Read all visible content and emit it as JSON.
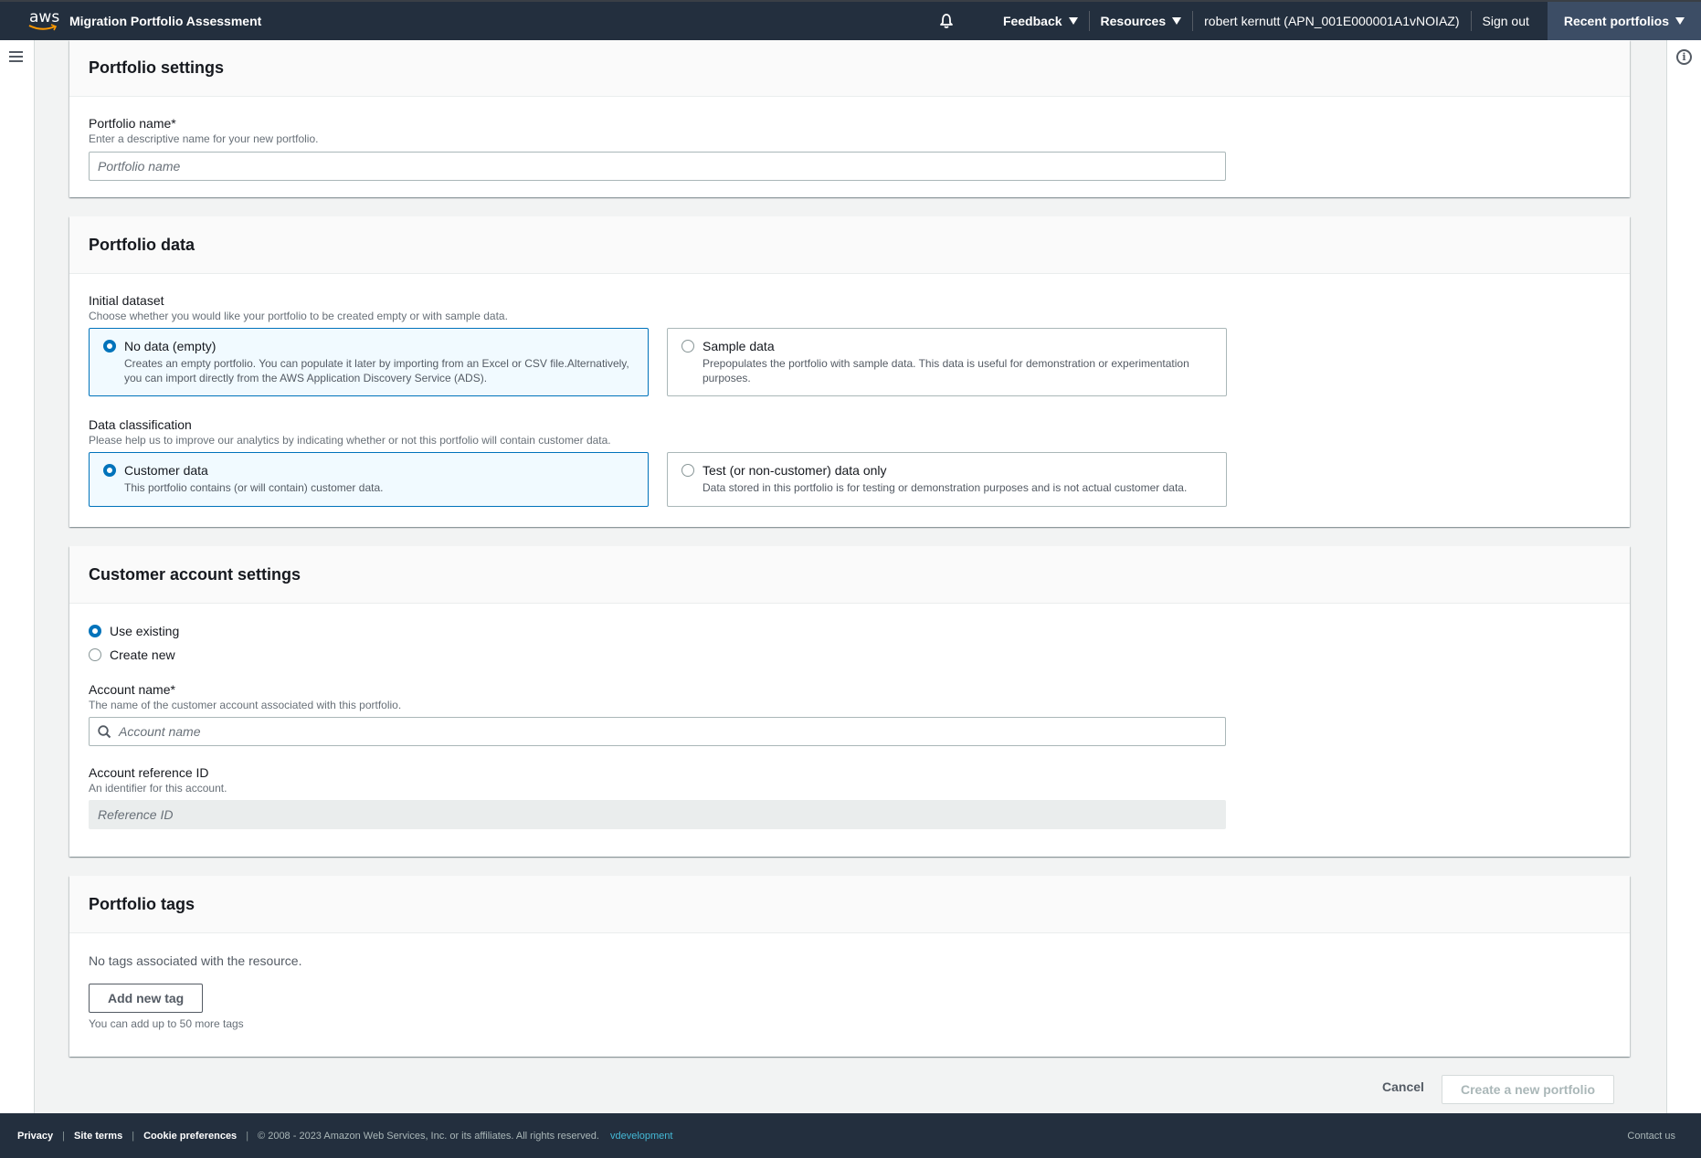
{
  "topnav": {
    "logo_text": "aws",
    "app_title": "Migration Portfolio Assessment",
    "feedback": "Feedback",
    "resources": "Resources",
    "user": "robert kernutt (APN_001E000001A1vNOIAZ)",
    "sign_out": "Sign out",
    "recent_portfolios": "Recent portfolios"
  },
  "portfolio_settings": {
    "title": "Portfolio settings",
    "name_label": "Portfolio name*",
    "name_desc": "Enter a descriptive name for your new portfolio.",
    "name_placeholder": "Portfolio name",
    "name_value": ""
  },
  "portfolio_data": {
    "title": "Portfolio data",
    "initial_dataset": {
      "label": "Initial dataset",
      "desc": "Choose whether you would like your portfolio to be created empty or with sample data.",
      "options": [
        {
          "title": "No data (empty)",
          "desc": "Creates an empty portfolio. You can populate it later by importing from an Excel or CSV file.Alternatively, you can import directly from the AWS Application Discovery Service (ADS).",
          "selected": true
        },
        {
          "title": "Sample data",
          "desc": "Prepopulates the portfolio with sample data. This data is useful for demonstration or experimentation purposes.",
          "selected": false
        }
      ]
    },
    "data_classification": {
      "label": "Data classification",
      "desc": "Please help us to improve our analytics by indicating whether or not this portfolio will contain customer data.",
      "options": [
        {
          "title": "Customer data",
          "desc": "This portfolio contains (or will contain) customer data.",
          "selected": true
        },
        {
          "title": "Test (or non-customer) data only",
          "desc": "Data stored in this portfolio is for testing or demonstration purposes and is not actual customer data.",
          "selected": false
        }
      ]
    }
  },
  "customer_account": {
    "title": "Customer account settings",
    "mode_options": [
      {
        "label": "Use existing",
        "selected": true
      },
      {
        "label": "Create new",
        "selected": false
      }
    ],
    "account_name_label": "Account name*",
    "account_name_desc": "The name of the customer account associated with this portfolio.",
    "account_name_placeholder": "Account name",
    "reference_label": "Account reference ID",
    "reference_desc": "An identifier for this account.",
    "reference_placeholder": "Reference ID"
  },
  "portfolio_tags": {
    "title": "Portfolio tags",
    "empty_text": "No tags associated with the resource.",
    "add_button": "Add new tag",
    "limit_text": "You can add up to 50 more tags"
  },
  "actions": {
    "cancel": "Cancel",
    "create": "Create a new portfolio"
  },
  "footer": {
    "privacy": "Privacy",
    "site_terms": "Site terms",
    "cookie_preferences": "Cookie preferences",
    "copyright": "© 2008 - 2023 Amazon Web Services, Inc. or its affiliates. All rights reserved.",
    "environment": "vdevelopment",
    "contact": "Contact us"
  },
  "colors": {
    "nav_bg": "#232f3e",
    "accent": "#0073bb",
    "selected_tile_bg": "#f1faff",
    "env_link": "#44b9d6"
  }
}
